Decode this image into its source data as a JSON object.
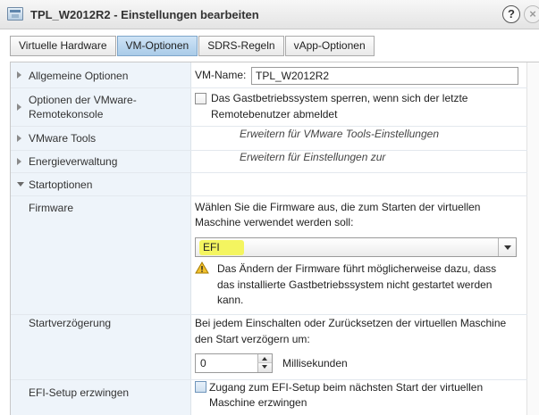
{
  "window": {
    "title": "TPL_W2012R2 - Einstellungen bearbeiten",
    "help_label": "?",
    "close_label": "×"
  },
  "tabs": [
    {
      "label": "Virtuelle Hardware",
      "active": false
    },
    {
      "label": "VM-Optionen",
      "active": true
    },
    {
      "label": "SDRS-Regeln",
      "active": false
    },
    {
      "label": "vApp-Optionen",
      "active": false
    }
  ],
  "sections": {
    "general": {
      "label": "Allgemeine Optionen",
      "vm_name_label": "VM-Name:",
      "vm_name_value": "TPL_W2012R2"
    },
    "remote_console": {
      "label_line1": "Optionen der VMware-",
      "label_line2": "Remotekonsole",
      "lock_line1": "Das Gastbetriebssystem sperren, wenn sich der letzte",
      "lock_line2": "Remotebenutzer abmeldet"
    },
    "vmware_tools": {
      "label": "VMware Tools",
      "hint": "Erweitern für VMware Tools-Einstellungen"
    },
    "power": {
      "label": "Energieverwaltung",
      "hint": "Erweitern für Einstellungen zur"
    },
    "boot": {
      "label": "Startoptionen"
    },
    "firmware": {
      "label": "Firmware",
      "desc_line1": "Wählen Sie die Firmware aus, die zum Starten der virtuellen",
      "desc_line2": "Maschine verwendet werden soll:",
      "selected": "EFI",
      "warning_line1": "Das Ändern der Firmware führt möglicherweise dazu, dass",
      "warning_line2": "das installierte Gastbetriebssystem nicht gestartet werden",
      "warning_line3": "kann."
    },
    "boot_delay": {
      "label": "Startverzögerung",
      "desc_line1": "Bei jedem Einschalten oder Zurücksetzen der virtuellen Maschine",
      "desc_line2": "den Start verzögern um:",
      "value": "0",
      "unit": "Millisekunden"
    },
    "efi_setup": {
      "label": "EFI-Setup erzwingen",
      "desc_line1": "Zugang zum EFI-Setup beim nächsten Start der virtuellen",
      "desc_line2": "Maschine erzwingen"
    }
  },
  "colors": {
    "tab_active": "#a9cbe8",
    "left_column": "#eef4fa",
    "highlight": "#f4f560"
  }
}
